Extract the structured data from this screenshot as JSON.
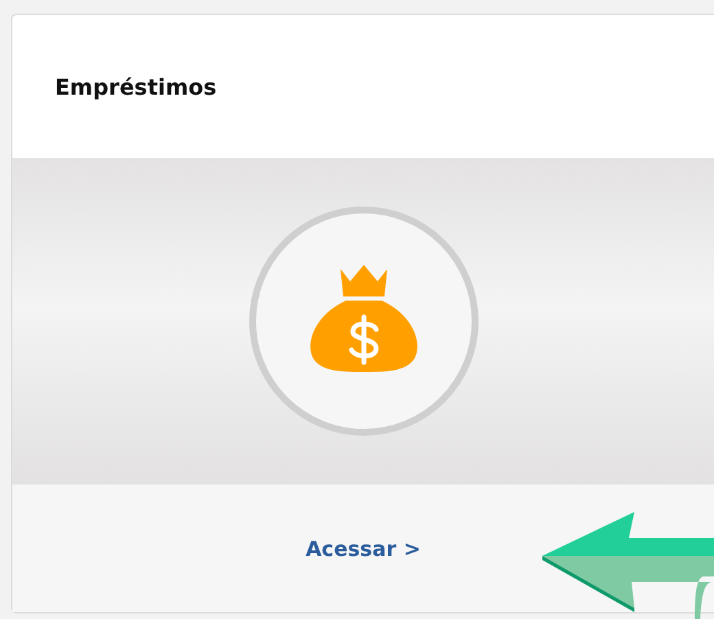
{
  "card": {
    "title": "Empréstimos",
    "link": "Acessar >"
  }
}
